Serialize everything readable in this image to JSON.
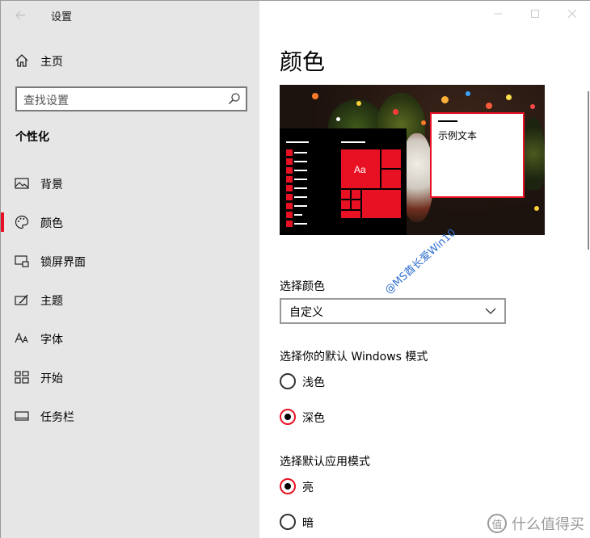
{
  "app": {
    "title": "设置"
  },
  "sidebar": {
    "home_label": "主页",
    "search_placeholder": "查找设置",
    "section_title": "个性化",
    "items": [
      {
        "label": "背景",
        "icon": "picture-icon",
        "selected": false
      },
      {
        "label": "颜色",
        "icon": "palette-icon",
        "selected": true
      },
      {
        "label": "锁屏界面",
        "icon": "lockscreen-icon",
        "selected": false
      },
      {
        "label": "主题",
        "icon": "theme-icon",
        "selected": false
      },
      {
        "label": "字体",
        "icon": "font-icon",
        "selected": false
      },
      {
        "label": "开始",
        "icon": "start-icon",
        "selected": false
      },
      {
        "label": "任务栏",
        "icon": "taskbar-icon",
        "selected": false
      }
    ]
  },
  "main": {
    "page_title": "颜色",
    "preview": {
      "sample_text": "示例文本",
      "tile_text": "Aa"
    },
    "choose_color_label": "选择颜色",
    "choose_color_value": "自定义",
    "windows_mode_label": "选择你的默认 Windows 模式",
    "windows_mode_options": [
      {
        "label": "浅色",
        "selected": false
      },
      {
        "label": "深色",
        "selected": true
      }
    ],
    "app_mode_label": "选择默认应用模式",
    "app_mode_options": [
      {
        "label": "亮",
        "selected": true
      },
      {
        "label": "暗",
        "selected": false
      }
    ]
  },
  "watermarks": {
    "diagonal": "@MS酋长爱Win10",
    "corner": "什么值得买",
    "corner_logo": "值"
  },
  "colors": {
    "accent": "#e81123",
    "sidebar_bg": "#e6e6e6"
  }
}
